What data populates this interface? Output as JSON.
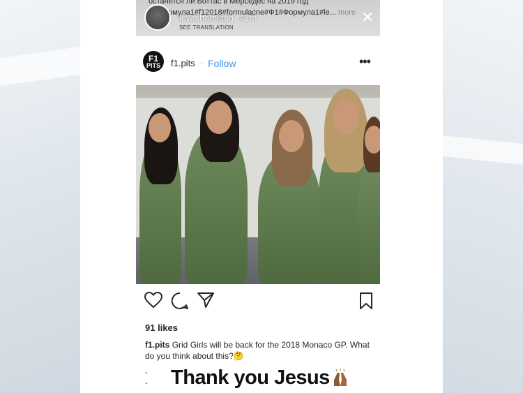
{
  "story": {
    "caption_line": "останется ли Боттас в Мерседес на 2019 год",
    "tags_line": "ормула1#f12018#formulacne#Ф1#Формула1#le...",
    "more_label": "more",
    "username": "lewishamilton",
    "time": "41m",
    "translate_label": "SEE TRANSLATION",
    "close_icon_glyph": "✕"
  },
  "post": {
    "avatar_text_top": "F1",
    "avatar_text_bottom": "PITS",
    "username": "f1.pits",
    "separator": "·",
    "follow_label": "Follow",
    "more_glyph": "•••",
    "photo_alt": ""
  },
  "actions": {
    "like_icon": "heart-icon",
    "comment_icon": "comment-icon",
    "share_icon": "share-icon",
    "save_icon": "bookmark-icon"
  },
  "likes_label": "91 likes",
  "caption": {
    "username": "f1.pits",
    "text": "Grid Girls will be back for the 2018 Monaco GP. What do you think about this?🤔"
  },
  "comments": [
    "-",
    "-"
  ],
  "overlay": {
    "text": "Thank you Jesus"
  },
  "colors": {
    "link_blue": "#3897f0",
    "text_dark": "#262626"
  }
}
